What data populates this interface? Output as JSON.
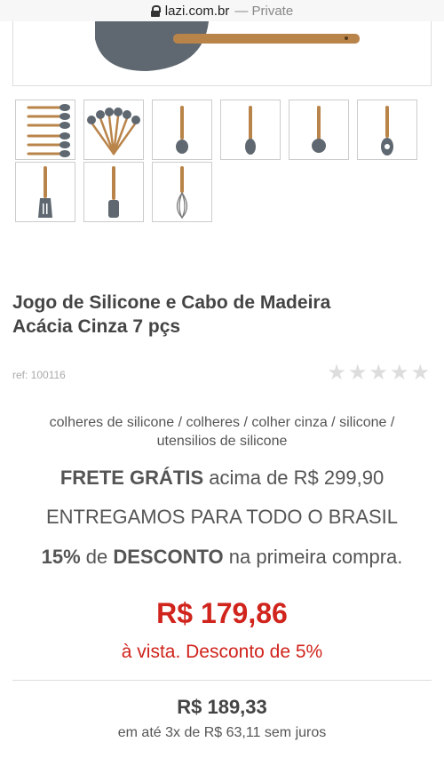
{
  "browser": {
    "url": "lazi.com.br",
    "private_label": "— Private"
  },
  "product": {
    "title_line1": "Jogo de Silicone e Cabo de Madeira",
    "title_line2": "Acácia Cinza 7 pçs",
    "ref": "ref: 100116",
    "rating_stars": 0,
    "rating_max": 5,
    "tags": [
      "colheres de silicone",
      "colheres",
      "colher cinza",
      "silicone",
      "utensilios de silicone"
    ]
  },
  "promo": {
    "shipping_strong": "FRETE GRÁTIS",
    "shipping_text": " acima de R$ 299,90",
    "delivery": "ENTREGAMOS PARA TODO O BRASIL",
    "discount_pct": "15%",
    "discount_de": " de ",
    "discount_strong": "DESCONTO",
    "discount_text": " na primeira compra."
  },
  "pricing": {
    "cash_price": "R$ 179,86",
    "cash_note": "à vista. Desconto de 5%",
    "full_price": "R$ 189,33",
    "installments": "em até 3x de R$ 63,11 sem juros"
  },
  "colors": {
    "price_red": "#d0241c",
    "silicone_gray": "#5f6870",
    "wood": "#b9844a"
  },
  "thumbnails": [
    {
      "icon": "utensil-set-row-icon"
    },
    {
      "icon": "utensil-set-fan-icon"
    },
    {
      "icon": "ladle-icon"
    },
    {
      "icon": "spoon-icon"
    },
    {
      "icon": "round-spoon-icon"
    },
    {
      "icon": "pasta-server-icon"
    },
    {
      "icon": "slotted-turner-icon"
    },
    {
      "icon": "spatula-icon"
    },
    {
      "icon": "whisk-icon"
    }
  ]
}
